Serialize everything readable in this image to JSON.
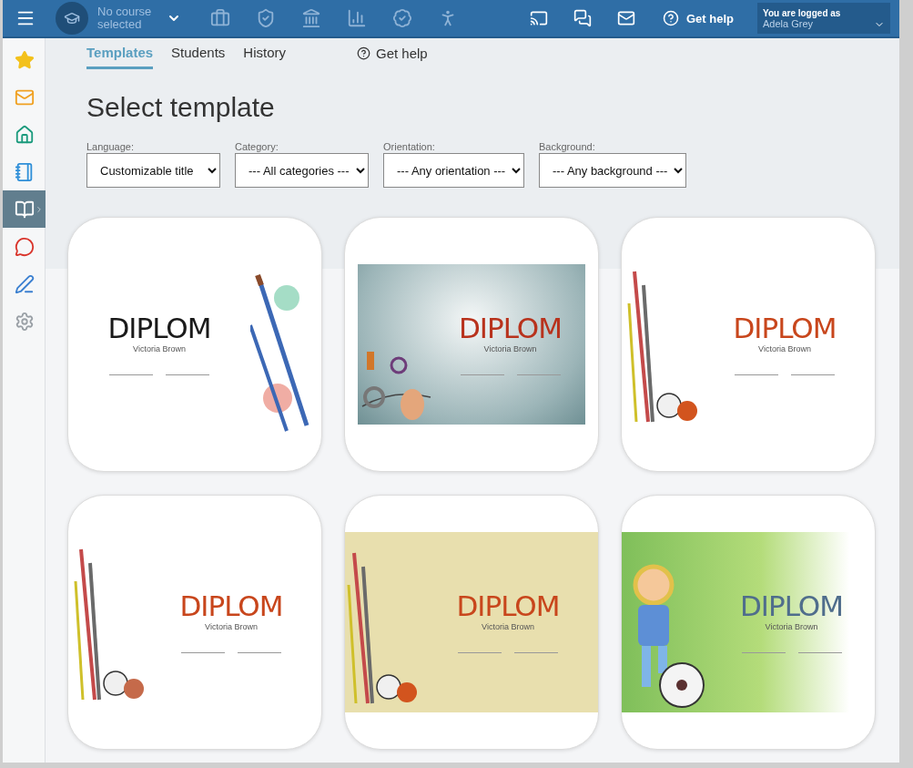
{
  "top_bar": {
    "course": "No course selected",
    "help": "Get help",
    "user_caption": "You are logged as",
    "user_name": "Adela Grey"
  },
  "sidebar": {
    "items": [
      {
        "kind": "star",
        "selected": false
      },
      {
        "kind": "mail",
        "selected": false
      },
      {
        "kind": "home",
        "selected": false
      },
      {
        "kind": "notebook",
        "selected": false
      },
      {
        "kind": "book",
        "selected": true
      },
      {
        "kind": "chat",
        "selected": false
      },
      {
        "kind": "pen",
        "selected": false
      },
      {
        "kind": "gear",
        "selected": false
      }
    ]
  },
  "tabs": [
    {
      "label": "Templates",
      "selected": true
    },
    {
      "label": "Students",
      "selected": false
    },
    {
      "label": "History",
      "selected": false
    }
  ],
  "help_link": "Get help",
  "title": "Select template",
  "filters": [
    {
      "label": "Language:",
      "value": "Customizable title"
    },
    {
      "label": "Category:",
      "value": "--- All categories ---"
    },
    {
      "label": "Orientation:",
      "value": "--- Any orientation ---"
    },
    {
      "label": "Background:",
      "value": "--- Any background ---"
    }
  ],
  "templates": [
    {
      "kind": "watercolor",
      "color": "#1a1a1a",
      "heading": "DIPLOM",
      "name": "Victoria Brown"
    },
    {
      "kind": "music",
      "color": "#b8321c",
      "heading": "DIPLOM",
      "name": "Victoria Brown"
    },
    {
      "kind": "sports",
      "color": "#c8461c",
      "heading": "DIPLOM",
      "name": "Victoria Brown"
    },
    {
      "kind": "sketch",
      "color": "#c8461c",
      "heading": "DIPLOM",
      "name": "Victoria Brown"
    },
    {
      "kind": "beige",
      "color": "#c8461c",
      "heading": "DIPLOM",
      "name": "Victoria Brown"
    },
    {
      "kind": "football",
      "color": "#4f6d8c",
      "heading": "DIPLOM",
      "name": "Victoria Brown"
    }
  ]
}
